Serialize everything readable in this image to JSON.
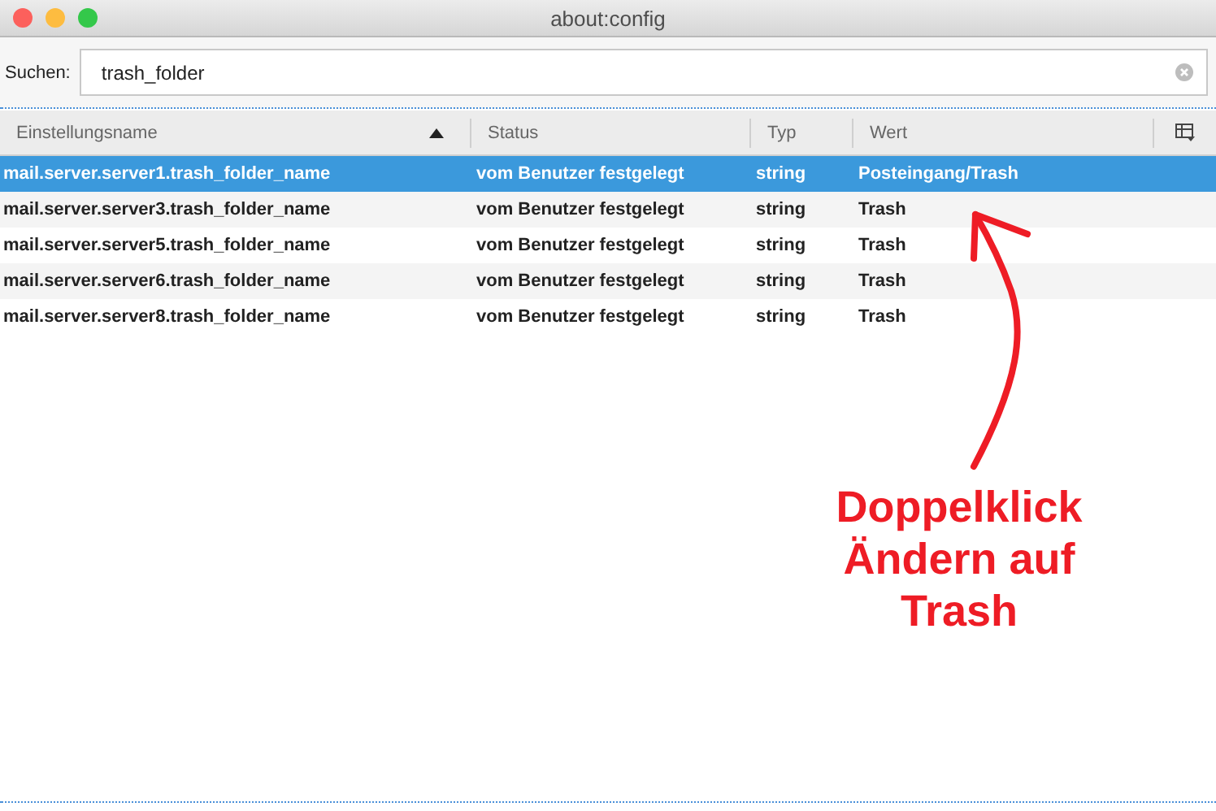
{
  "window": {
    "title": "about:config"
  },
  "search": {
    "label": "Suchen:",
    "value": "trash_folder"
  },
  "table": {
    "columns": [
      {
        "label": "Einstellungsname",
        "sorted": true
      },
      {
        "label": "Status",
        "sorted": false
      },
      {
        "label": "Typ",
        "sorted": false
      },
      {
        "label": "Wert",
        "sorted": false
      }
    ],
    "rows": [
      {
        "cells": [
          "mail.server.server1.trash_folder_name",
          "vom Benutzer festgelegt",
          "string",
          "Posteingang/Trash"
        ],
        "selected": true
      },
      {
        "cells": [
          "mail.server.server3.trash_folder_name",
          "vom Benutzer festgelegt",
          "string",
          "Trash"
        ],
        "selected": false
      },
      {
        "cells": [
          "mail.server.server5.trash_folder_name",
          "vom Benutzer festgelegt",
          "string",
          "Trash"
        ],
        "selected": false
      },
      {
        "cells": [
          "mail.server.server6.trash_folder_name",
          "vom Benutzer festgelegt",
          "string",
          "Trash"
        ],
        "selected": false
      },
      {
        "cells": [
          "mail.server.server8.trash_folder_name",
          "vom Benutzer festgelegt",
          "string",
          "Trash"
        ],
        "selected": false
      }
    ]
  },
  "annotation": {
    "text": "Doppelklick\nÄndern auf\nTrash"
  }
}
